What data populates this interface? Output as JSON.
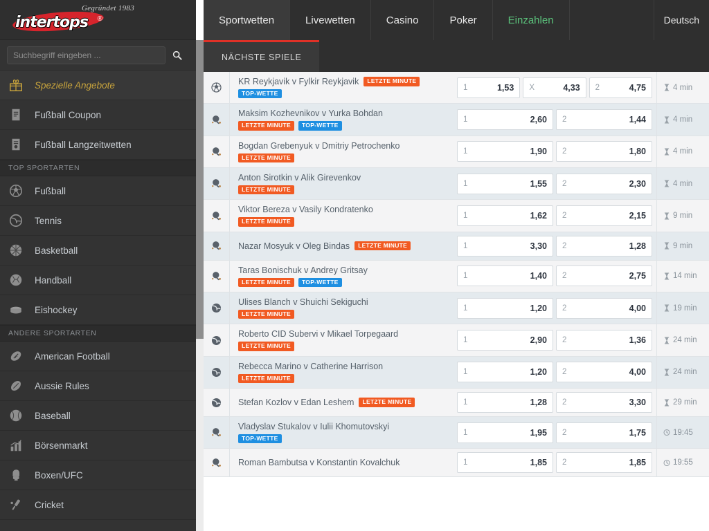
{
  "brand": {
    "name": "intertops",
    "tagline": "Gegründet 1983"
  },
  "search": {
    "placeholder": "Suchbegriff eingeben ...",
    "value": "",
    "icon": "search-icon"
  },
  "topnav": {
    "items": [
      {
        "label": "Sportwetten",
        "state": "active"
      },
      {
        "label": "Livewetten",
        "state": "normal"
      },
      {
        "label": "Casino",
        "state": "normal"
      },
      {
        "label": "Poker",
        "state": "normal"
      },
      {
        "label": "Einzahlen",
        "state": "accent"
      }
    ],
    "language": "Deutsch",
    "accent_color": "#5bc27b"
  },
  "sidebar": {
    "items": [
      {
        "label": "Spezielle Angebote",
        "icon": "gift-icon",
        "style": "special"
      },
      {
        "label": "Fußball Coupon",
        "icon": "coupon-icon",
        "style": "normal"
      },
      {
        "label": "Fußball Langzeitwetten",
        "icon": "coupon-clock-icon",
        "style": "normal"
      }
    ],
    "sections": [
      {
        "heading": "TOP SPORTARTEN",
        "items": [
          {
            "label": "Fußball",
            "icon": "soccer-ball-icon"
          },
          {
            "label": "Tennis",
            "icon": "tennis-ball-icon"
          },
          {
            "label": "Basketball",
            "icon": "basketball-icon"
          },
          {
            "label": "Handball",
            "icon": "handball-icon"
          },
          {
            "label": "Eishockey",
            "icon": "hockey-puck-icon"
          }
        ]
      },
      {
        "heading": "ANDERE SPORTARTEN",
        "items": [
          {
            "label": "American Football",
            "icon": "american-football-icon"
          },
          {
            "label": "Aussie Rules",
            "icon": "aussie-rules-icon"
          },
          {
            "label": "Baseball",
            "icon": "baseball-icon"
          },
          {
            "label": "Börsenmarkt",
            "icon": "bar-chart-icon"
          },
          {
            "label": "Boxen/UFC",
            "icon": "boxing-glove-icon"
          },
          {
            "label": "Cricket",
            "icon": "cricket-bat-icon"
          }
        ]
      }
    ]
  },
  "content": {
    "tab_label": "NÄCHSTE SPIELE",
    "tab_accent_color": "#e03127",
    "badge_colors": {
      "letzte_minute": "#f15a22",
      "top_wette": "#1e8fe1"
    },
    "rows": [
      {
        "sport_icon": "soccer-ball-icon",
        "match": "KR Reykjavik v Fylkir Reykjavik",
        "badges_inline": [
          "LETZTE MINUTE"
        ],
        "badges_below": [
          "TOP-WETTE"
        ],
        "odds": [
          {
            "key": "1",
            "value": "1,53"
          },
          {
            "key": "X",
            "value": "4,33"
          },
          {
            "key": "2",
            "value": "4,75"
          }
        ],
        "time": "4 min",
        "time_icon": "hourglass-icon"
      },
      {
        "sport_icon": "table-tennis-icon",
        "match": "Maksim Kozhevnikov v Yurka Bohdan",
        "badges_inline": [],
        "badges_below": [
          "LETZTE MINUTE",
          "TOP-WETTE"
        ],
        "odds": [
          {
            "key": "1",
            "value": "2,60"
          },
          {
            "key": "2",
            "value": "1,44"
          }
        ],
        "time": "4 min",
        "time_icon": "hourglass-icon"
      },
      {
        "sport_icon": "table-tennis-icon",
        "match": "Bogdan Grebenyuk v Dmitriy Petrochenko",
        "badges_inline": [],
        "badges_below": [
          "LETZTE MINUTE"
        ],
        "odds": [
          {
            "key": "1",
            "value": "1,90"
          },
          {
            "key": "2",
            "value": "1,80"
          }
        ],
        "time": "4 min",
        "time_icon": "hourglass-icon"
      },
      {
        "sport_icon": "table-tennis-icon",
        "match": "Anton Sirotkin v Alik Girevenkov",
        "badges_inline": [],
        "badges_below": [
          "LETZTE MINUTE"
        ],
        "odds": [
          {
            "key": "1",
            "value": "1,55"
          },
          {
            "key": "2",
            "value": "2,30"
          }
        ],
        "time": "4 min",
        "time_icon": "hourglass-icon"
      },
      {
        "sport_icon": "table-tennis-icon",
        "match": "Viktor Bereza v Vasily Kondratenko",
        "badges_inline": [],
        "badges_below": [
          "LETZTE MINUTE"
        ],
        "odds": [
          {
            "key": "1",
            "value": "1,62"
          },
          {
            "key": "2",
            "value": "2,15"
          }
        ],
        "time": "9 min",
        "time_icon": "hourglass-icon"
      },
      {
        "sport_icon": "table-tennis-icon",
        "match": "Nazar Mosyuk v Oleg Bindas",
        "badges_inline": [
          "LETZTE MINUTE"
        ],
        "badges_below": [],
        "odds": [
          {
            "key": "1",
            "value": "3,30"
          },
          {
            "key": "2",
            "value": "1,28"
          }
        ],
        "time": "9 min",
        "time_icon": "hourglass-icon"
      },
      {
        "sport_icon": "table-tennis-icon",
        "match": "Taras Bonischuk v Andrey Gritsay",
        "badges_inline": [],
        "badges_below": [
          "LETZTE MINUTE",
          "TOP-WETTE"
        ],
        "odds": [
          {
            "key": "1",
            "value": "1,40"
          },
          {
            "key": "2",
            "value": "2,75"
          }
        ],
        "time": "14 min",
        "time_icon": "hourglass-icon"
      },
      {
        "sport_icon": "tennis-ball-icon",
        "match": "Ulises Blanch v Shuichi Sekiguchi",
        "badges_inline": [],
        "badges_below": [
          "LETZTE MINUTE"
        ],
        "odds": [
          {
            "key": "1",
            "value": "1,20"
          },
          {
            "key": "2",
            "value": "4,00"
          }
        ],
        "time": "19 min",
        "time_icon": "hourglass-icon"
      },
      {
        "sport_icon": "tennis-ball-icon",
        "match": "Roberto CID Subervi v Mikael Torpegaard",
        "badges_inline": [],
        "badges_below": [
          "LETZTE MINUTE"
        ],
        "odds": [
          {
            "key": "1",
            "value": "2,90"
          },
          {
            "key": "2",
            "value": "1,36"
          }
        ],
        "time": "24 min",
        "time_icon": "hourglass-icon"
      },
      {
        "sport_icon": "tennis-ball-icon",
        "match": "Rebecca Marino v Catherine Harrison",
        "badges_inline": [],
        "badges_below": [
          "LETZTE MINUTE"
        ],
        "odds": [
          {
            "key": "1",
            "value": "1,20"
          },
          {
            "key": "2",
            "value": "4,00"
          }
        ],
        "time": "24 min",
        "time_icon": "hourglass-icon"
      },
      {
        "sport_icon": "tennis-ball-icon",
        "match": "Stefan Kozlov v Edan Leshem",
        "badges_inline": [
          "LETZTE MINUTE"
        ],
        "badges_below": [],
        "odds": [
          {
            "key": "1",
            "value": "1,28"
          },
          {
            "key": "2",
            "value": "3,30"
          }
        ],
        "time": "29 min",
        "time_icon": "hourglass-icon"
      },
      {
        "sport_icon": "table-tennis-icon",
        "match": "Vladyslav Stukalov v Iulii Khomutovskyi",
        "badges_inline": [],
        "badges_below": [
          "TOP-WETTE"
        ],
        "odds": [
          {
            "key": "1",
            "value": "1,95"
          },
          {
            "key": "2",
            "value": "1,75"
          }
        ],
        "time": "19:45",
        "time_icon": "clock-icon"
      },
      {
        "sport_icon": "table-tennis-icon",
        "match": "Roman Bambutsa v Konstantin Kovalchuk",
        "badges_inline": [],
        "badges_below": [],
        "odds": [
          {
            "key": "1",
            "value": "1,85"
          },
          {
            "key": "2",
            "value": "1,85"
          }
        ],
        "time": "19:55",
        "time_icon": "clock-icon"
      }
    ]
  }
}
